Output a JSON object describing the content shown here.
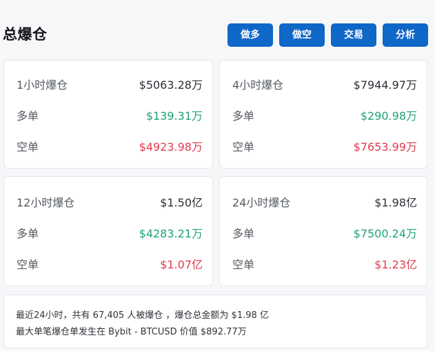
{
  "header": {
    "title": "总爆仓",
    "buttons": {
      "long": "做多",
      "short": "做空",
      "trade": "交易",
      "analysis": "分析"
    }
  },
  "cards": [
    {
      "period_label": "1小时爆仓",
      "total": "$5063.28万",
      "long_label": "多单",
      "long_value": "$139.31万",
      "short_label": "空单",
      "short_value": "$4923.98万"
    },
    {
      "period_label": "4小时爆仓",
      "total": "$7944.97万",
      "long_label": "多单",
      "long_value": "$290.98万",
      "short_label": "空单",
      "short_value": "$7653.99万"
    },
    {
      "period_label": "12小时爆仓",
      "total": "$1.50亿",
      "long_label": "多单",
      "long_value": "$4283.21万",
      "short_label": "空单",
      "short_value": "$1.07亿"
    },
    {
      "period_label": "24小时爆仓",
      "total": "$1.98亿",
      "long_label": "多单",
      "long_value": "$7500.24万",
      "short_label": "空单",
      "short_value": "$1.23亿"
    }
  ],
  "summary": {
    "line1": "最近24小时，共有 67,405 人被爆仓 ，爆仓总金额为 $1.98 亿",
    "line2": "最大单笔爆仓单发生在 Bybit - BTCUSD 价值 $892.77万"
  },
  "colors": {
    "button_bg": "#0f67c8",
    "long_green": "#1ea27a",
    "short_red": "#e03b4f"
  }
}
